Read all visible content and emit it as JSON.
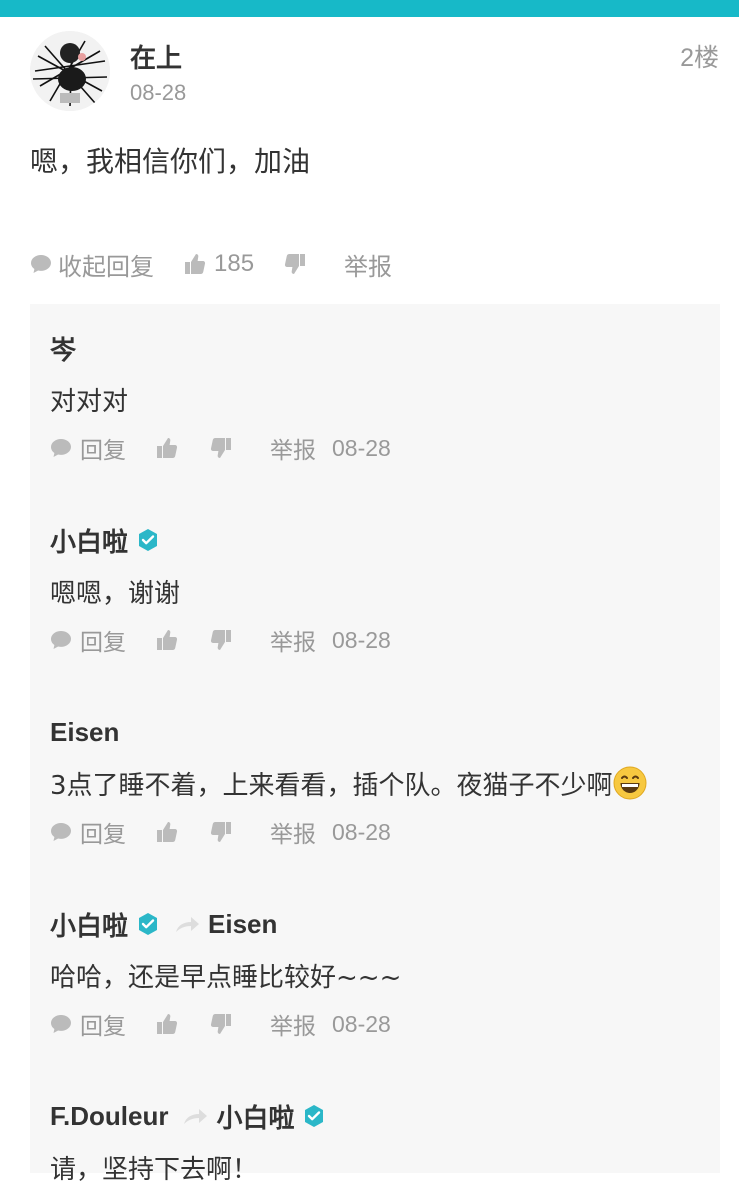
{
  "post": {
    "author": "在上",
    "date": "08-28",
    "floor": "2楼",
    "body": "嗯，我相信你们，加油",
    "actions": {
      "collapse_label": "收起回复",
      "like_count": "185",
      "report_label": "举报"
    }
  },
  "replies": [
    {
      "name": "岑",
      "text": "对对对",
      "reply_label": "回复",
      "report_label": "举报",
      "date": "08-28"
    },
    {
      "name": "小白啦",
      "verified": true,
      "text": "嗯嗯，谢谢",
      "reply_label": "回复",
      "report_label": "举报",
      "date": "08-28"
    },
    {
      "name": "Eisen",
      "text": "3点了睡不着，上来看看，插个队。夜猫子不少啊",
      "emoji": "grinning-face",
      "reply_label": "回复",
      "report_label": "举报",
      "date": "08-28"
    },
    {
      "name": "小白啦",
      "verified": true,
      "to": "Eisen",
      "text": "哈哈，还是早点睡比较好~~~",
      "reply_label": "回复",
      "report_label": "举报",
      "date": "08-28"
    },
    {
      "name": "F.Douleur",
      "to": "小白啦",
      "to_verified": true,
      "text": "请，坚持下去啊！"
    }
  ],
  "colors": {
    "accent": "#17b9c8",
    "badge": "#2bb7c8",
    "muted": "#999999",
    "panel": "#f7f7f7"
  }
}
